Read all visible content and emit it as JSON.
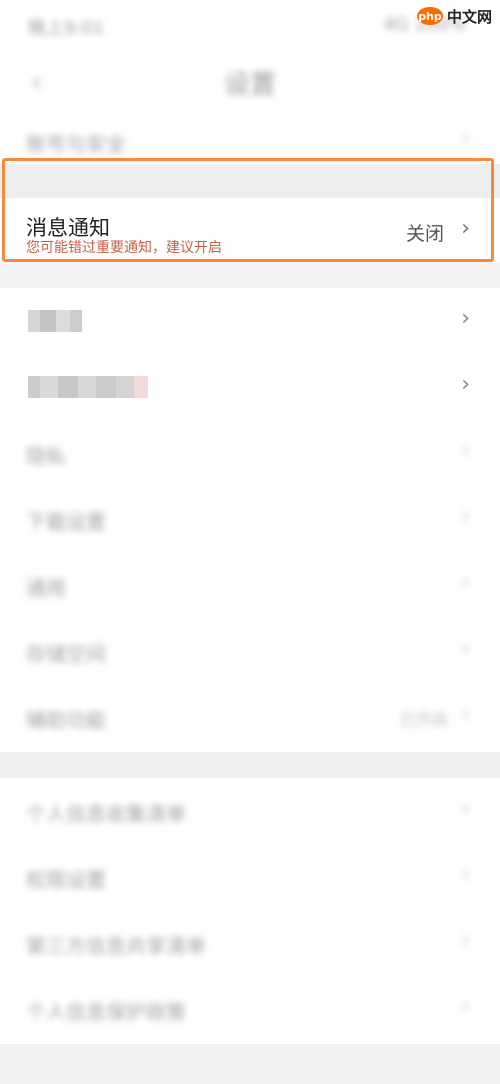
{
  "watermark": {
    "logo": "php",
    "text": "中文网"
  },
  "status_bar": {
    "time": "晚上9:01",
    "right": "4G  100%"
  },
  "header": {
    "back_icon": "chevron-left-icon",
    "title": "设置"
  },
  "top_item": {
    "label": "账号与安全"
  },
  "notification": {
    "title": "消息通知",
    "subtitle": "您可能错过重要通知，建议开启",
    "value": "关闭",
    "highlight_color": "#f68a3c",
    "subtitle_color": "#c6614a"
  },
  "section1": {
    "items": [
      {
        "label": ""
      },
      {
        "label": ""
      },
      {
        "label": "隐私"
      },
      {
        "label": "下载设置"
      },
      {
        "label": "通用"
      },
      {
        "label": "存储空间"
      },
      {
        "label": "辅助功能",
        "value": "已开启"
      }
    ]
  },
  "section2": {
    "items": [
      {
        "label": "个人信息收集清单"
      },
      {
        "label": "权限设置"
      },
      {
        "label": "第三方信息共享清单"
      },
      {
        "label": "个人信息保护政策"
      }
    ]
  }
}
